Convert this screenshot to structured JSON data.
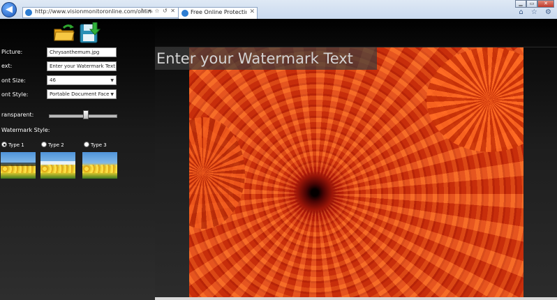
{
  "browser": {
    "address": "http://www.visionmonitoronline.com/online-apps/protecting-",
    "address_icons": "↻ ▾ ☆ ↺ ✕",
    "tab_title": "Free Online Protecting A...",
    "tab_close": "✕",
    "back_glyph": "◀",
    "forward_glyph": "▶",
    "window_controls": [
      "▁",
      "▭",
      "✕"
    ],
    "toolbar_icons": "⌂ ☆ ⚙"
  },
  "toolbar": {
    "open_icon": "folder-open-icon",
    "save_icon": "floppy-save-icon"
  },
  "form": {
    "picture_label": "Picture:",
    "picture_value": "Chrysanthemum.jpg",
    "text_label": "ext:",
    "text_value": "Enter your Watermark Text",
    "font_size_label": "ont Size:",
    "font_size_value": "46",
    "font_style_label": "ont Style:",
    "font_style_value": "Portable Document Face",
    "transparent_label": "ransparent:",
    "transparency": 0.52
  },
  "watermark_style": {
    "label": "Watermark Style:",
    "types": [
      {
        "label": "Type 1",
        "selected": true
      },
      {
        "label": "Type 2",
        "selected": false
      },
      {
        "label": "Type 3",
        "selected": false
      }
    ]
  },
  "preview": {
    "watermark_text": "Enter your Watermark Text",
    "image_subject": "chrysanthemum"
  },
  "colors": {
    "panel_bg": "#000000",
    "flower_orange": "#e8481a",
    "watermark_band": "#3c3c3c"
  }
}
